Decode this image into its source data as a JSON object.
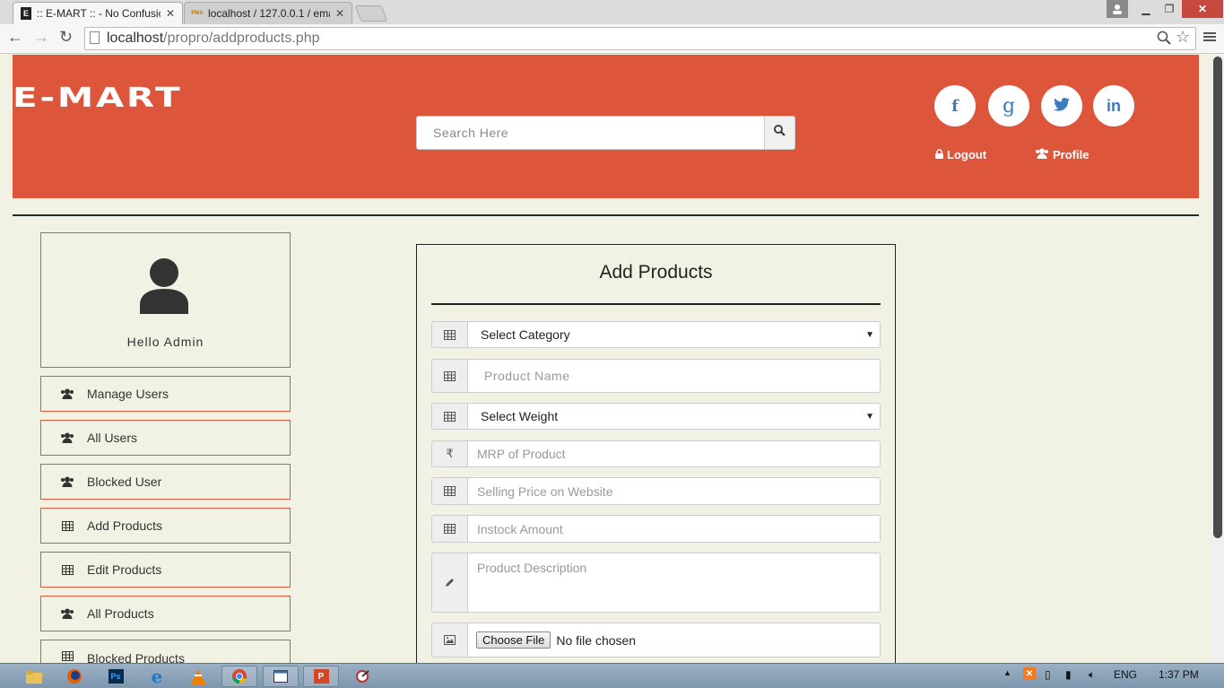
{
  "browser": {
    "tabs": [
      {
        "favicon": "E",
        "title": ":: E-MART :: - No Confusio",
        "active": true
      },
      {
        "favicon": "PMA",
        "title": "localhost / 127.0.0.1 / ema",
        "active": false
      }
    ],
    "url_host": "localhost",
    "url_path": "/propro/addproducts.php"
  },
  "header": {
    "logo_text": "E-MART",
    "search_placeholder": "Search Here",
    "social": [
      {
        "icon": "facebook-icon",
        "glyph": "f"
      },
      {
        "icon": "google-icon",
        "glyph": "g"
      },
      {
        "icon": "twitter-icon",
        "glyph": "t"
      },
      {
        "icon": "linkedin-icon",
        "glyph": "in"
      }
    ],
    "logout_label": "Logout",
    "profile_label": "Profile",
    "brand_color": "#dd553b"
  },
  "sidebar": {
    "greeting": "Hello Admin",
    "items": [
      {
        "label": "Manage Users",
        "icon": "users-icon"
      },
      {
        "label": "All Users",
        "icon": "users-icon"
      },
      {
        "label": "Blocked User",
        "icon": "users-icon"
      },
      {
        "label": "Add Products",
        "icon": "table-icon"
      },
      {
        "label": "Edit Products",
        "icon": "table-icon"
      },
      {
        "label": "All Products",
        "icon": "users-icon"
      },
      {
        "label": "Blocked Products",
        "icon": "table-icon"
      }
    ]
  },
  "form": {
    "title": "Add Products",
    "category_selected": "Select Category",
    "name_placeholder": "Product Name",
    "weight_selected": "Select Weight",
    "rupee_symbol": "₹",
    "mrp_placeholder": "MRP of Product",
    "selling_placeholder": "Selling Price on Website",
    "instock_placeholder": "Instock Amount",
    "description_placeholder": "Product Description",
    "file_button": "Choose File",
    "file_status": "No file chosen"
  },
  "taskbar": {
    "language": "ENG",
    "time": "1:37 PM"
  }
}
